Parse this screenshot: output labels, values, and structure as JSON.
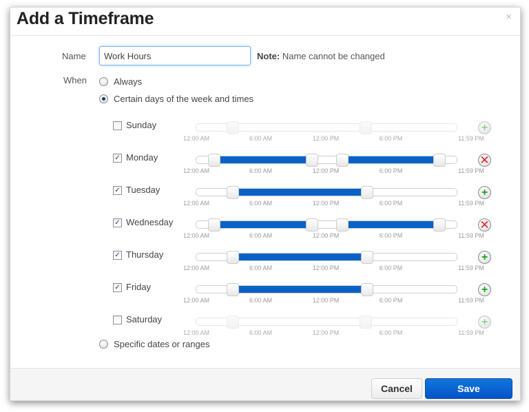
{
  "dialog": {
    "title": "Add a Timeframe",
    "close_icon": "close-x-icon",
    "close_glyph": "×"
  },
  "form": {
    "name_label": "Name",
    "name_value": "Work Hours",
    "note_bold": "Note:",
    "note_text": " Name cannot be changed",
    "when_label": "When",
    "options": [
      {
        "label": "Always",
        "selected": false
      },
      {
        "label": "Certain days of the week and times",
        "selected": true
      },
      {
        "label": "Specific dates or ranges",
        "selected": false
      }
    ]
  },
  "tick_labels": [
    "12:00 AM",
    "6:00 AM",
    "12:00 PM",
    "6:00 PM",
    "11:59 PM"
  ],
  "days": [
    {
      "label": "Sunday",
      "checked": false,
      "ranges": [
        [
          0.14,
          0.65
        ]
      ],
      "action": "add",
      "action_glyph": "+"
    },
    {
      "label": "Monday",
      "checked": true,
      "ranges": [
        [
          0.07,
          0.445
        ],
        [
          0.56,
          0.935
        ]
      ],
      "action": "remove",
      "action_glyph": "✕"
    },
    {
      "label": "Tuesday",
      "checked": true,
      "ranges": [
        [
          0.14,
          0.655
        ]
      ],
      "action": "add",
      "action_glyph": "+"
    },
    {
      "label": "Wednesday",
      "checked": true,
      "ranges": [
        [
          0.07,
          0.445
        ],
        [
          0.56,
          0.935
        ]
      ],
      "action": "remove",
      "action_glyph": "✕"
    },
    {
      "label": "Thursday",
      "checked": true,
      "ranges": [
        [
          0.14,
          0.655
        ]
      ],
      "action": "add",
      "action_glyph": "+"
    },
    {
      "label": "Friday",
      "checked": true,
      "ranges": [
        [
          0.14,
          0.655
        ]
      ],
      "action": "add",
      "action_glyph": "+"
    },
    {
      "label": "Saturday",
      "checked": false,
      "ranges": [
        [
          0.14,
          0.65
        ]
      ],
      "action": "add",
      "action_glyph": "+"
    }
  ],
  "footer": {
    "cancel_label": "Cancel",
    "save_label": "Save"
  },
  "colors": {
    "range_fill": "#0a62c7",
    "save_button": "#0a62d0",
    "add_icon": "#13a11b",
    "remove_icon": "#e21b1b"
  }
}
